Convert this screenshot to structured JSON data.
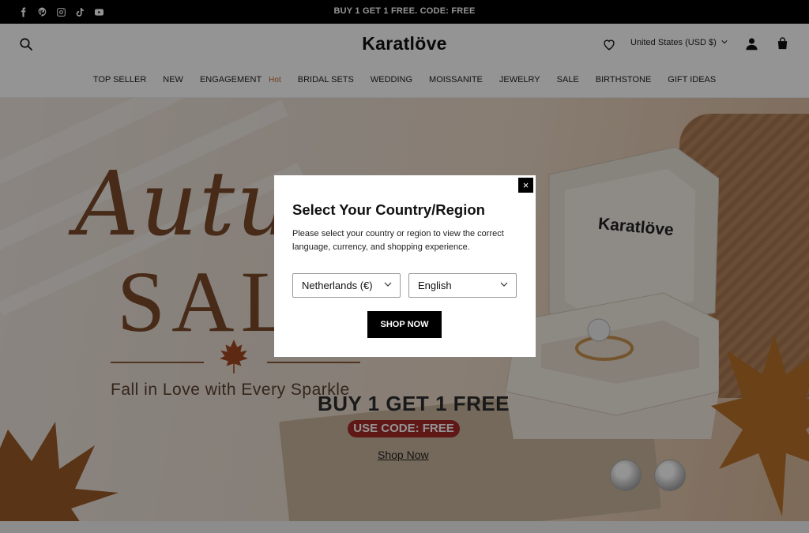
{
  "topbar": {
    "promo": "BUY 1 GET 1 FREE. CODE: FREE",
    "social": [
      "facebook-icon",
      "pinterest-icon",
      "instagram-icon",
      "tiktok-icon",
      "youtube-icon"
    ]
  },
  "header": {
    "logo": "Karatlöve",
    "currency": "United States (USD $)",
    "nav": [
      {
        "label": "TOP SELLER"
      },
      {
        "label": "NEW"
      },
      {
        "label": "ENGAGEMENT",
        "badge": "Hot"
      },
      {
        "label": "BRIDAL SETS"
      },
      {
        "label": "WEDDING"
      },
      {
        "label": "MOISSANITE"
      },
      {
        "label": "JEWELRY"
      },
      {
        "label": "SALE"
      },
      {
        "label": "BIRTHSTONE"
      },
      {
        "label": "GIFT IDEAS"
      }
    ]
  },
  "hero": {
    "title_script": "Autu",
    "title_main": "SAL",
    "tagline": "Fall in Love with Every Sparkle",
    "offer": "BUY 1 GET 1 FREE",
    "code": "USE CODE: FREE",
    "link": "Shop Now",
    "box_brand": "Karatlöve"
  },
  "modal": {
    "close": "×",
    "title": "Select Your Country/Region",
    "description": "Please select your country or region to view the correct language, currency, and shopping experience.",
    "country": "Netherlands (€)",
    "language": "English",
    "button": "SHOP NOW"
  },
  "colors": {
    "accent_hot": "#c8642e",
    "code_badge": "#a42a26",
    "hero_text": "#7a4a2a"
  }
}
